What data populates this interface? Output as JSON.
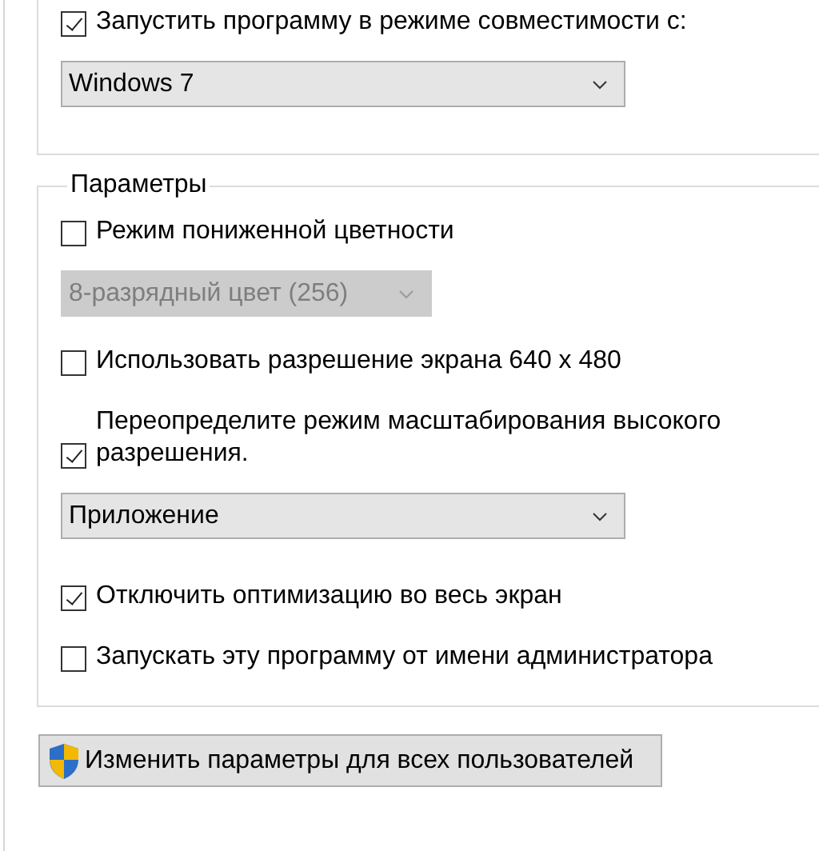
{
  "compatibility": {
    "checkbox": {
      "label": "Запустить программу в режиме совместимости с:",
      "checked": true
    },
    "dropdown": {
      "value": "Windows 7",
      "disabled": false
    }
  },
  "settings": {
    "title": "Параметры",
    "items": [
      {
        "kind": "checkbox",
        "label": "Режим пониженной цветности",
        "checked": false
      },
      {
        "kind": "dropdown",
        "value": "8-разрядный цвет (256)",
        "disabled": true
      },
      {
        "kind": "checkbox",
        "label": "Использовать разрешение экрана 640 x 480",
        "checked": false
      },
      {
        "kind": "checkbox",
        "label": "Переопределите режим масштабирования высокого разрешения.",
        "checked": true
      },
      {
        "kind": "dropdown",
        "value": "Приложение",
        "disabled": false
      },
      {
        "kind": "checkbox",
        "label": "Отключить оптимизацию во весь экран",
        "checked": true
      },
      {
        "kind": "checkbox",
        "label": "Запускать эту программу от имени администратора",
        "checked": false
      }
    ]
  },
  "button": {
    "label": "Изменить параметры для всех пользователей"
  }
}
